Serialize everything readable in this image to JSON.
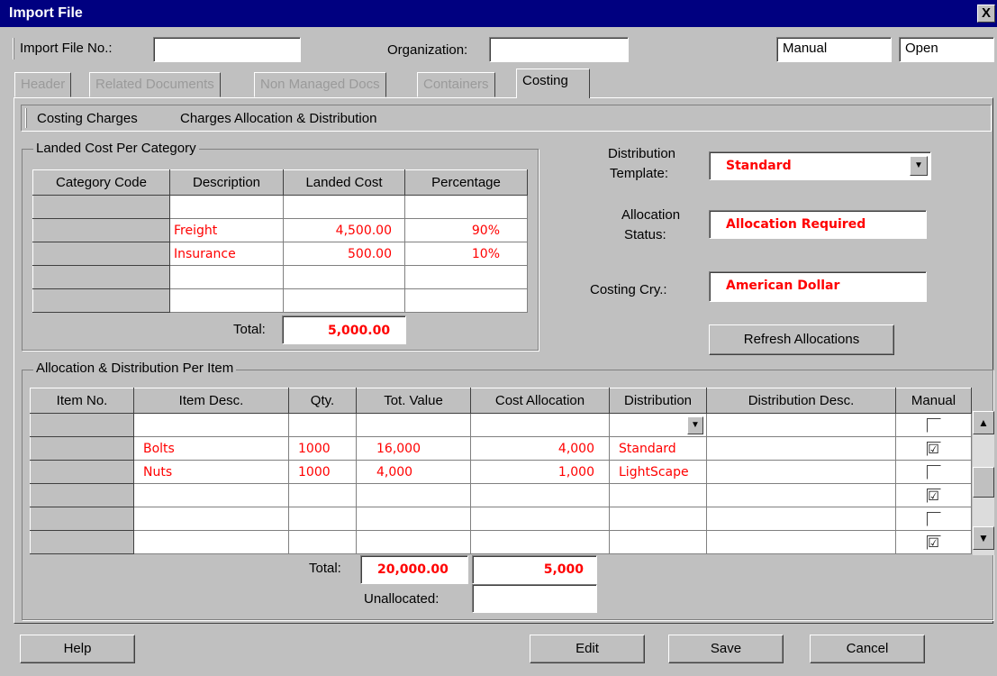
{
  "window": {
    "title": "Import File",
    "close_glyph": "X"
  },
  "header": {
    "import_file_no_label": "Import File No.:",
    "import_file_no_value": "",
    "organization_label": "Organization:",
    "organization_value": "",
    "mode_value": "Manual",
    "status_value": "Open"
  },
  "tabs": [
    {
      "label": "Header",
      "active": false
    },
    {
      "label": "Related Documents",
      "active": false
    },
    {
      "label": "Non Managed Docs",
      "active": false
    },
    {
      "label": "Containers",
      "active": false
    },
    {
      "label": "Costing",
      "active": true
    }
  ],
  "subtabs": {
    "costing_charges": "Costing Charges",
    "allocation": "Charges Allocation & Distribution"
  },
  "landed": {
    "title": "Landed Cost Per Category",
    "columns": [
      "Category Code",
      "Description",
      "Landed Cost",
      "Percentage"
    ],
    "rows": [
      {
        "description": "",
        "landed_cost": "",
        "percentage": ""
      },
      {
        "description": "Freight",
        "landed_cost": "4,500.00",
        "percentage": "90%"
      },
      {
        "description": "Insurance",
        "landed_cost": "500.00",
        "percentage": "10%"
      },
      {
        "description": "",
        "landed_cost": "",
        "percentage": ""
      },
      {
        "description": "",
        "landed_cost": "",
        "percentage": ""
      }
    ],
    "total_label": "Total:",
    "total_value": "5,000.00"
  },
  "right": {
    "template_label_1": "Distribution",
    "template_label_2": "Template:",
    "template_value": "Standard",
    "status_label_1": "Allocation",
    "status_label_2": "Status:",
    "status_value": "Allocation Required",
    "cry_label": "Costing Cry.:",
    "cry_value": "American Dollar",
    "refresh_label": "Refresh Allocations"
  },
  "alloc": {
    "title": "Allocation & Distribution Per Item",
    "columns": [
      "Item No.",
      "Item Desc.",
      "Qty.",
      "Tot. Value",
      "Cost Allocation",
      "Distribution",
      "Distribution Desc.",
      "Manual"
    ],
    "rows": [
      {
        "desc": "",
        "qty": "",
        "value": "",
        "cost": "",
        "dist": "",
        "manual": false
      },
      {
        "desc": "Bolts",
        "qty": "1000",
        "value": "16,000",
        "cost": "4,000",
        "dist": "Standard",
        "manual": true
      },
      {
        "desc": "Nuts",
        "qty": "1000",
        "value": "4,000",
        "cost": "1,000",
        "dist": "LightScape",
        "manual": false
      },
      {
        "desc": "",
        "qty": "",
        "value": "",
        "cost": "",
        "dist": "",
        "manual": true
      },
      {
        "desc": "",
        "qty": "",
        "value": "",
        "cost": "",
        "dist": "",
        "manual": false
      },
      {
        "desc": "",
        "qty": "",
        "value": "",
        "cost": "",
        "dist": "",
        "manual": true
      }
    ],
    "total_label": "Total:",
    "total_value": "20,000.00",
    "total_cost": "5,000",
    "unallocated_label": "Unallocated:",
    "unallocated_value": ""
  },
  "buttons": {
    "help": "Help",
    "edit": "Edit",
    "save": "Save",
    "cancel": "Cancel"
  },
  "icons": {
    "check": "☑",
    "arrow_up": "▲",
    "arrow_down": "▼",
    "dropdown": "▼"
  }
}
